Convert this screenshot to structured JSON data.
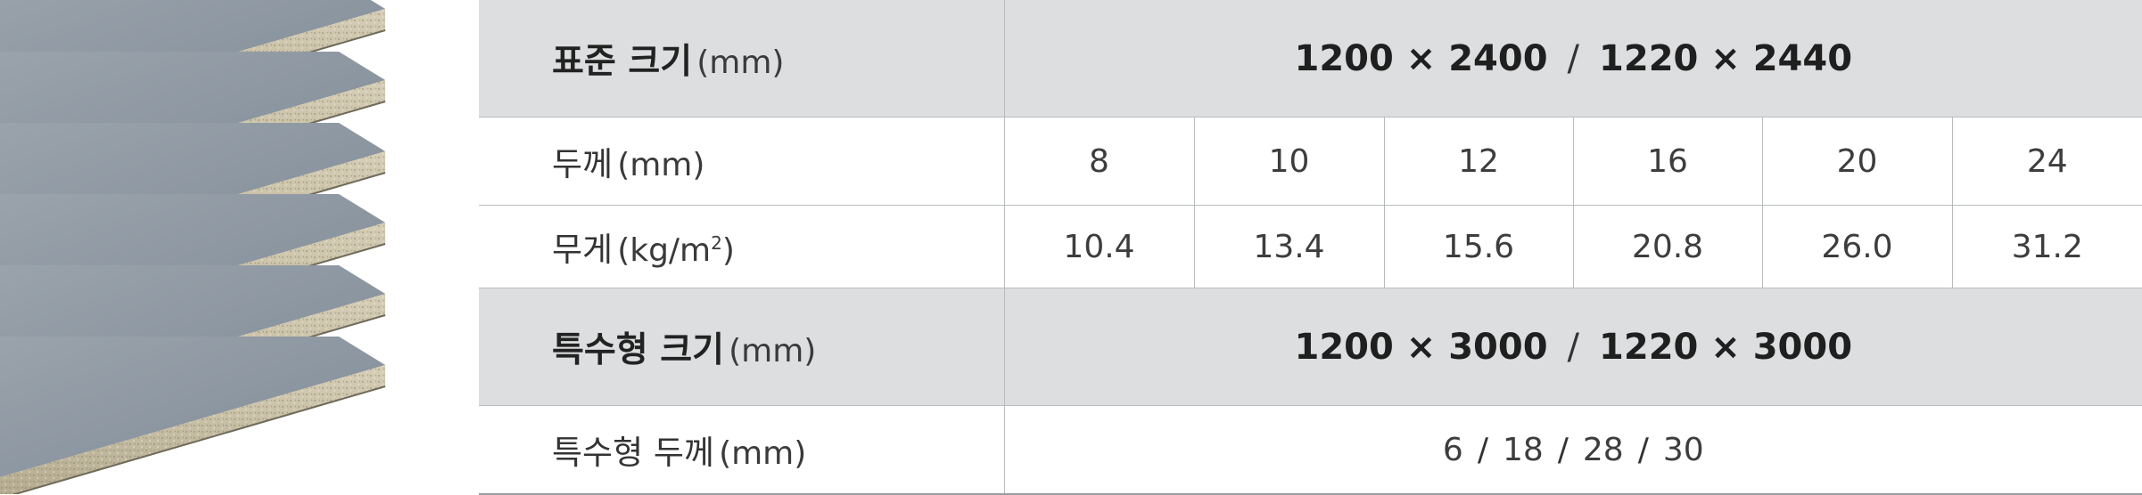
{
  "standard": {
    "label": "표준 크기",
    "unit": "(mm)",
    "size_a": "1200 × 2400",
    "separator": "/",
    "size_b": "1220 × 2440"
  },
  "thickness": {
    "label": "두께",
    "unit": "(mm)",
    "values": [
      "8",
      "10",
      "12",
      "16",
      "20",
      "24"
    ]
  },
  "weight": {
    "label": "무게",
    "unit": "(kg/m",
    "unit_sup": "2",
    "unit_close": ")",
    "values": [
      "10.4",
      "13.4",
      "15.6",
      "20.8",
      "26.0",
      "31.2"
    ]
  },
  "special_size": {
    "label": "특수형 크기",
    "unit": "(mm)",
    "size_a": "1200 × 3000",
    "separator": "/",
    "size_b": "1220 × 3000"
  },
  "special_thickness": {
    "label": "특수형 두께",
    "unit": "(mm)",
    "values": [
      "6",
      "18",
      "28",
      "30"
    ],
    "separator": "/"
  },
  "colors": {
    "header_bg": "#dcdedf",
    "border": "#b9bcbe",
    "board_top": "#8d97a1",
    "board_edge": "#c9c0a6"
  }
}
